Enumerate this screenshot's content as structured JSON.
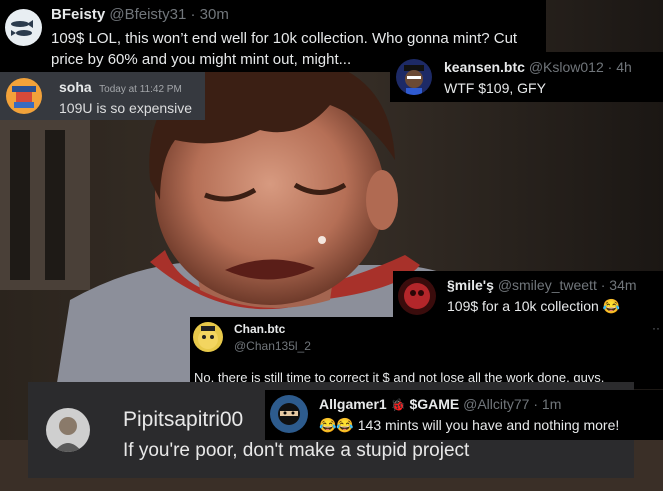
{
  "tweets": {
    "bfeisty": {
      "name": "BFeisty",
      "handle": "@Bfeisty31",
      "time": "· 30m",
      "line1": "109$ LOL,  this won’t end well for 10k collection.  Who gonna mint?  Cut",
      "line2": "price by 60% and you might mint out, might..."
    },
    "soha": {
      "name": "soha",
      "time": "Today at 11:42 PM",
      "text": "109U is so expensive"
    },
    "keansen": {
      "name": "keansen.btc",
      "handle": "@Kslow012",
      "time": "· 4h",
      "text": "WTF $109, GFY"
    },
    "smiles": {
      "name": "§mile'ş",
      "handle": "@smiley_tweett",
      "time": "· 34m",
      "text": "109$ for a 10k collection",
      "emoji": "😂"
    },
    "chan": {
      "name": "Chan.btc",
      "handle": "@Chan135l_2",
      "more": "··",
      "text": "No, there is still time to correct it $ and not lose all the work done, guys."
    },
    "pipitsa": {
      "name": "Pipitsapitri00",
      "text": "If you're poor, don't make a stupid project"
    },
    "allgamer": {
      "name": "Allgamer1",
      "badge": "🐞",
      "tag": "$GAME",
      "handle": "@Allcity77",
      "time": "· 1m",
      "emojis": "😂😂",
      "text": "143 mints will you have and nothing more!"
    }
  }
}
